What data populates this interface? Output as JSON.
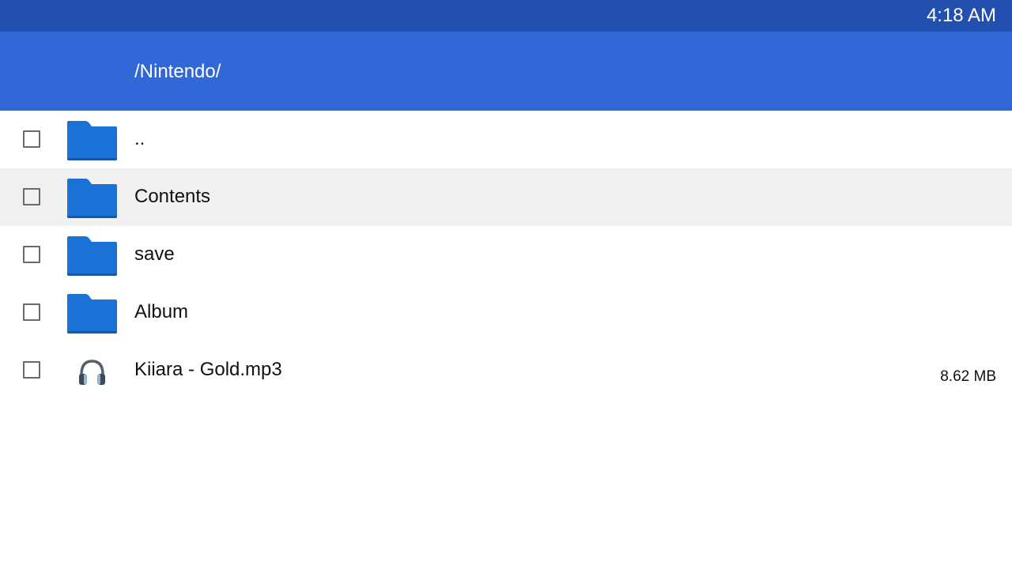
{
  "status_bar": {
    "time": "4:18 AM"
  },
  "header": {
    "path": "/Nintendo/"
  },
  "colors": {
    "status_bar_bg": "#234fae",
    "header_bg": "#3267d8",
    "folder_icon": "#1a72d6",
    "selected_row_bg": "#f0f0f0"
  },
  "files": [
    {
      "name": "..",
      "icon": "folder-icon",
      "size": "",
      "selected": false
    },
    {
      "name": "Contents",
      "icon": "folder-icon",
      "size": "",
      "selected": true
    },
    {
      "name": "save",
      "icon": "folder-icon",
      "size": "",
      "selected": false
    },
    {
      "name": "Album",
      "icon": "folder-icon",
      "size": "",
      "selected": false
    },
    {
      "name": "Kiiara - Gold.mp3",
      "icon": "headphones-icon",
      "size": "8.62 MB",
      "selected": false
    }
  ]
}
